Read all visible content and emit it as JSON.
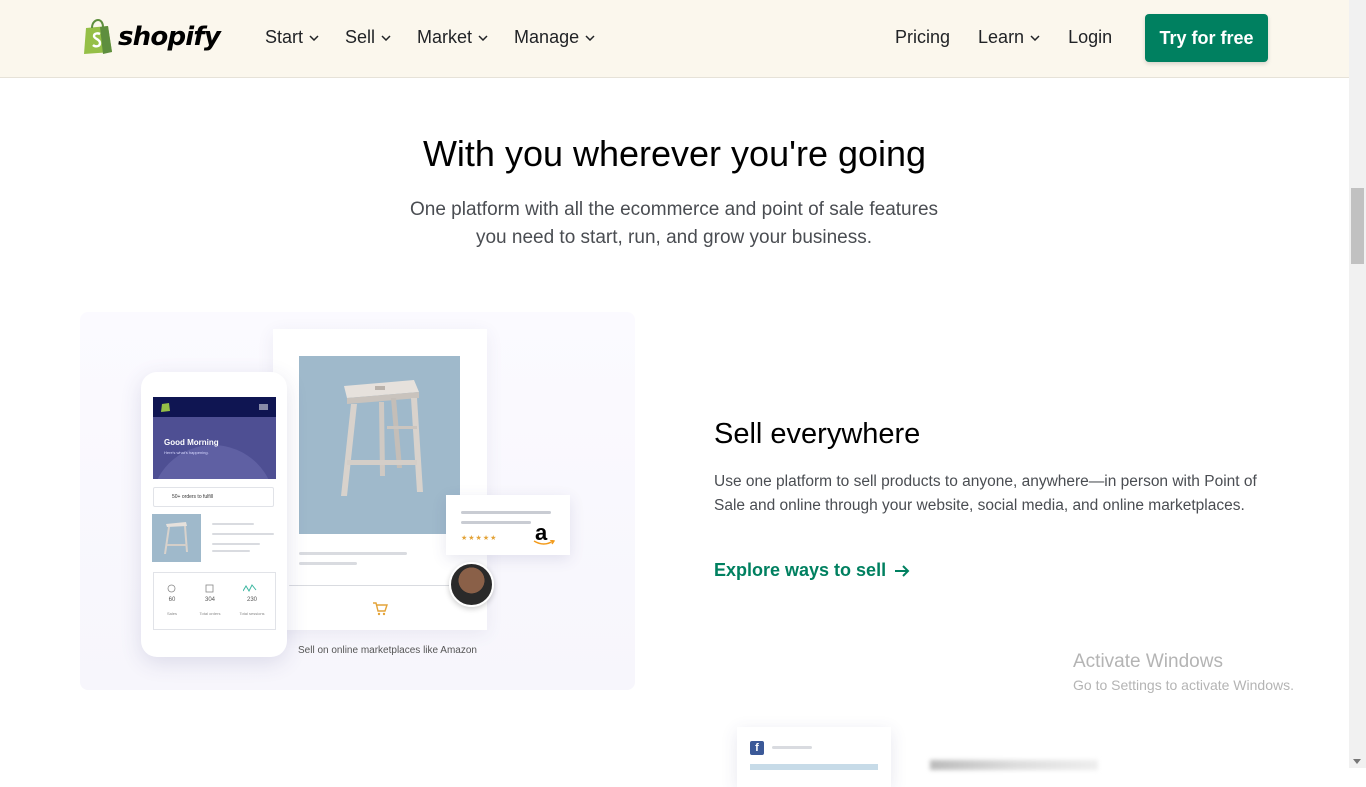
{
  "header": {
    "brand": "shopify",
    "nav": [
      {
        "label": "Start"
      },
      {
        "label": "Sell"
      },
      {
        "label": "Market"
      },
      {
        "label": "Manage"
      }
    ],
    "pricing": "Pricing",
    "learn": "Learn",
    "login": "Login",
    "cta": "Try for free"
  },
  "hero": {
    "title": "With you wherever you're going",
    "subtitle_line1": "One platform with all the ecommerce and point of sale features",
    "subtitle_line2": "you need to start, run, and grow your business."
  },
  "illustration": {
    "greeting": "Good Morning",
    "greeting_sub": "Here's what's happening.",
    "orders": "50+ orders to fulfill",
    "stats": [
      {
        "value": "60",
        "label": "Sales"
      },
      {
        "value": "304",
        "label": "Total orders"
      },
      {
        "value": "230",
        "label": "Total sessions"
      }
    ],
    "stars": "★★★★★",
    "amazon_letter": "a",
    "caption": "Sell on online marketplaces like Amazon"
  },
  "feature": {
    "title": "Sell everywhere",
    "body": "Use one platform to sell products to anyone, anywhere—in person with Point of Sale and online through your website, social media, and online marketplaces.",
    "link": "Explore ways to sell",
    "link_icon": "arrow-right-icon"
  },
  "watermark": {
    "title": "Activate Windows",
    "subtitle": "Go to Settings to activate Windows."
  },
  "colors": {
    "header_bg": "#fbf7ed",
    "brand_green": "#008060",
    "text": "#212326"
  }
}
